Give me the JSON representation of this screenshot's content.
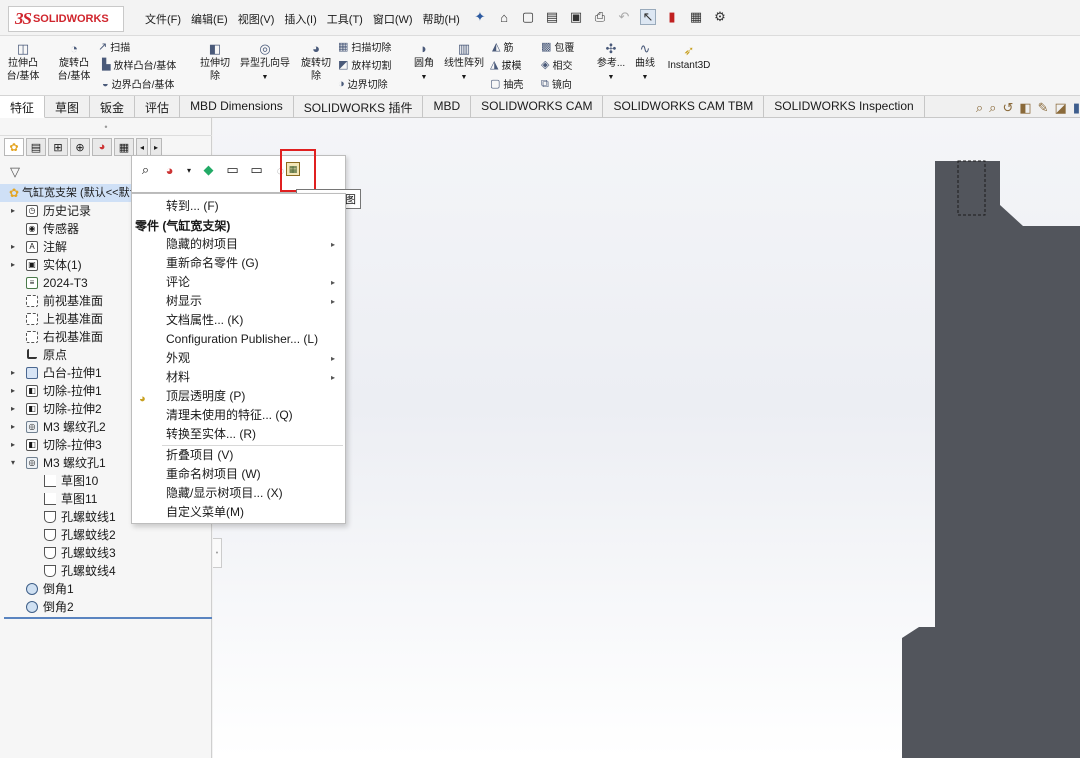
{
  "app": {
    "logo_ds": "3S",
    "logo_text": "SOLIDWORKS"
  },
  "menu_bar": [
    "文件(F)",
    "编辑(E)",
    "视图(V)",
    "插入(I)",
    "工具(T)",
    "窗口(W)",
    "帮助(H)"
  ],
  "ribbon": {
    "extrude_boss": [
      "拉伸凸",
      "台/基体"
    ],
    "revolve_boss": [
      "旋转凸",
      "台/基体"
    ],
    "sweep": "扫描",
    "loft_boss": "放样凸台/基体",
    "boundary_boss": "边界凸台/基体",
    "extrude_cut": [
      "拉伸切",
      "除"
    ],
    "hole_wizard": "异型孔向导",
    "revolve_cut": [
      "旋转切",
      "除"
    ],
    "swept_cut": "扫描切除",
    "lofted_cut": "放样切割",
    "boundary_cut": "边界切除",
    "fillet": "圆角",
    "linear_pattern": "线性阵列",
    "rib": "筋",
    "draft": "拔模",
    "shell": "抽壳",
    "wrap": "包覆",
    "intersect": "相交",
    "mirror": "镜向",
    "reference": "参考...",
    "curves": "曲线",
    "instant3d": "Instant3D"
  },
  "tabs": [
    "特征",
    "草图",
    "钣金",
    "评估",
    "MBD Dimensions",
    "SOLIDWORKS 插件",
    "MBD",
    "SOLIDWORKS CAM",
    "SOLIDWORKS CAM TBM",
    "SOLIDWORKS Inspection"
  ],
  "tree": {
    "root": "气缸宽支架 (默认<<默认>_显示状态 1>)",
    "items": [
      {
        "label": "历史记录"
      },
      {
        "label": "传感器"
      },
      {
        "label": "注解"
      },
      {
        "label": "实体(1)"
      },
      {
        "label": "2024-T3"
      },
      {
        "label": "前视基准面"
      },
      {
        "label": "上视基准面"
      },
      {
        "label": "右视基准面"
      },
      {
        "label": "原点"
      },
      {
        "label": "凸台-拉伸1"
      },
      {
        "label": "切除-拉伸1"
      },
      {
        "label": "切除-拉伸2"
      },
      {
        "label": "M3 螺纹孔2"
      },
      {
        "label": "切除-拉伸3"
      },
      {
        "label": "M3 螺纹孔1"
      },
      {
        "label": "草图10"
      },
      {
        "label": "草图11"
      },
      {
        "label": "孔螺蚊线1"
      },
      {
        "label": "孔螺蚊线2"
      },
      {
        "label": "孔螺蚊线3"
      },
      {
        "label": "孔螺蚊线4"
      },
      {
        "label": "倒角1"
      },
      {
        "label": "倒角2"
      }
    ]
  },
  "context_menu": {
    "tooltip": "打开工程图",
    "goto": "转到... (F)",
    "header": "零件 (气缸宽支架)",
    "items": [
      {
        "label": "隐藏的树项目",
        "submenu": true
      },
      {
        "label": "重新命名零件 (G)",
        "submenu": false
      },
      {
        "label": "评论",
        "submenu": true
      },
      {
        "label": "树显示",
        "submenu": true
      },
      {
        "label": "文档属性... (K)",
        "submenu": false
      },
      {
        "label": "Configuration Publisher... (L)",
        "submenu": false
      },
      {
        "label": "外观",
        "submenu": true
      },
      {
        "label": "材料",
        "submenu": true
      },
      {
        "label": "顶层透明度 (P)",
        "submenu": false
      },
      {
        "label": "清理未使用的特征... (Q)",
        "submenu": false
      },
      {
        "label": "转换至实体... (R)",
        "submenu": false
      },
      {
        "label": "折叠项目 (V)",
        "submenu": false
      },
      {
        "label": "重命名树项目 (W)",
        "submenu": false
      },
      {
        "label": "隐藏/显示树项目... (X)",
        "submenu": false
      },
      {
        "label": "自定义菜单(M)",
        "submenu": false
      }
    ]
  },
  "colors": {
    "part_body": "#52555c",
    "highlight_box": "#e02020",
    "tree_selection": "#cfe0f6"
  }
}
